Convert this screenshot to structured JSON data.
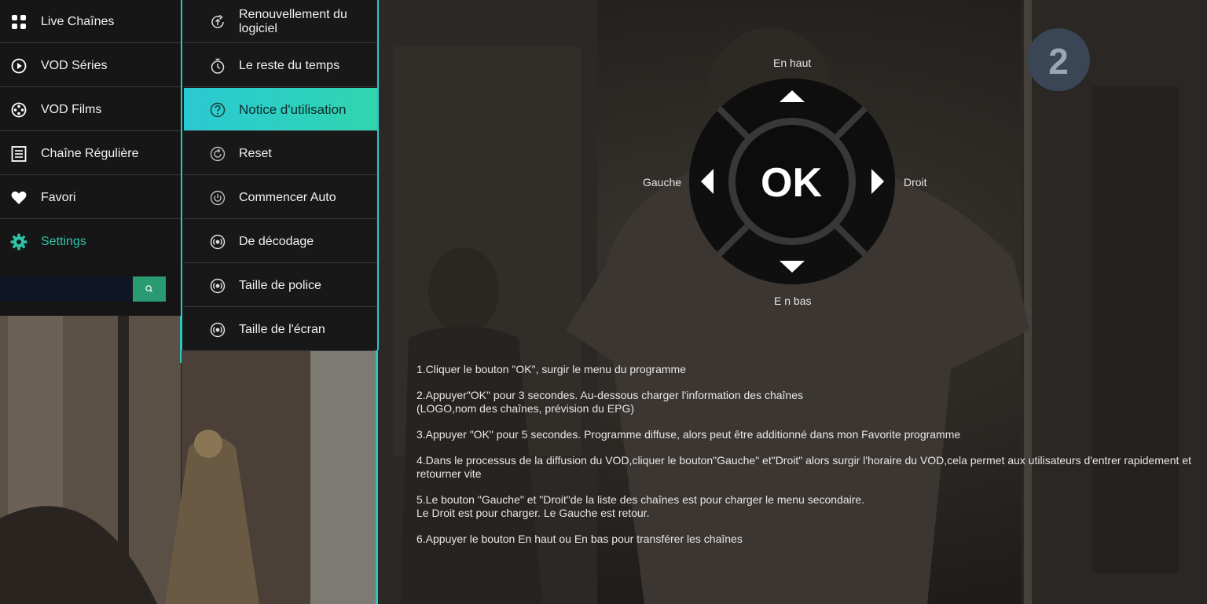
{
  "main_menu": {
    "items": [
      {
        "label": "Live Chaînes",
        "icon": "grid-icon"
      },
      {
        "label": "VOD Séries",
        "icon": "play-circle-icon"
      },
      {
        "label": "VOD Films",
        "icon": "film-reel-icon"
      },
      {
        "label": "Chaîne Régulière",
        "icon": "document-list-icon"
      },
      {
        "label": "Favori",
        "icon": "heart-icon"
      },
      {
        "label": "Settings",
        "icon": "gear-icon",
        "active": true
      }
    ]
  },
  "search": {
    "placeholder": "",
    "value": "",
    "icon": "search-icon"
  },
  "sub_menu": {
    "items": [
      {
        "label": "Renouvellement du logiciel",
        "icon": "update-icon"
      },
      {
        "label": "Le reste du temps",
        "icon": "timer-icon"
      },
      {
        "label": "Notice d'utilisation",
        "icon": "help-icon",
        "active": true
      },
      {
        "label": "Reset",
        "icon": "reset-icon"
      },
      {
        "label": "Commencer Auto",
        "icon": "power-icon"
      },
      {
        "label": "De décodage",
        "icon": "radio-icon"
      },
      {
        "label": "Taille de police",
        "icon": "radio-icon"
      },
      {
        "label": "Taille de l'écran",
        "icon": "radio-icon"
      }
    ]
  },
  "dpad": {
    "ok_label": "OK",
    "up_label": "En haut",
    "down_label": "E n bas",
    "left_label": "Gauche",
    "right_label": "Droit"
  },
  "instructions": [
    {
      "lines": [
        "1.Cliquer le bouton \"OK\", surgir le menu du programme"
      ]
    },
    {
      "lines": [
        "2.Appuyer\"OK\" pour 3 secondes. Au-dessous charger l'information des chaînes",
        "(LOGO,nom des chaînes, prévision du EPG)"
      ]
    },
    {
      "lines": [
        "3.Appuyer \"OK\" pour 5 secondes. Programme diffuse, alors peut être additionné dans mon Favorite programme"
      ]
    },
    {
      "lines": [
        "4.Dans le processus de la diffusion du VOD,cliquer le bouton\"Gauche\" et\"Droit\" alors surgir l'horaire du VOD,cela permet aux utilisateurs d'entrer rapidement et",
        "retourner vite"
      ]
    },
    {
      "lines": [
        "5.Le bouton \"Gauche\" et \"Droit\"de la liste des chaînes est pour charger le menu secondaire.",
        "Le Droit est pour charger. Le Gauche est retour."
      ]
    },
    {
      "lines": [
        "6.Appuyer le bouton En haut ou En bas pour transférer les chaînes"
      ]
    }
  ],
  "colors": {
    "accent": "#2ec4a8",
    "active_gradient_start": "#2bc9d4",
    "active_gradient_end": "#30d5ae",
    "search_button": "#2a9a72"
  }
}
